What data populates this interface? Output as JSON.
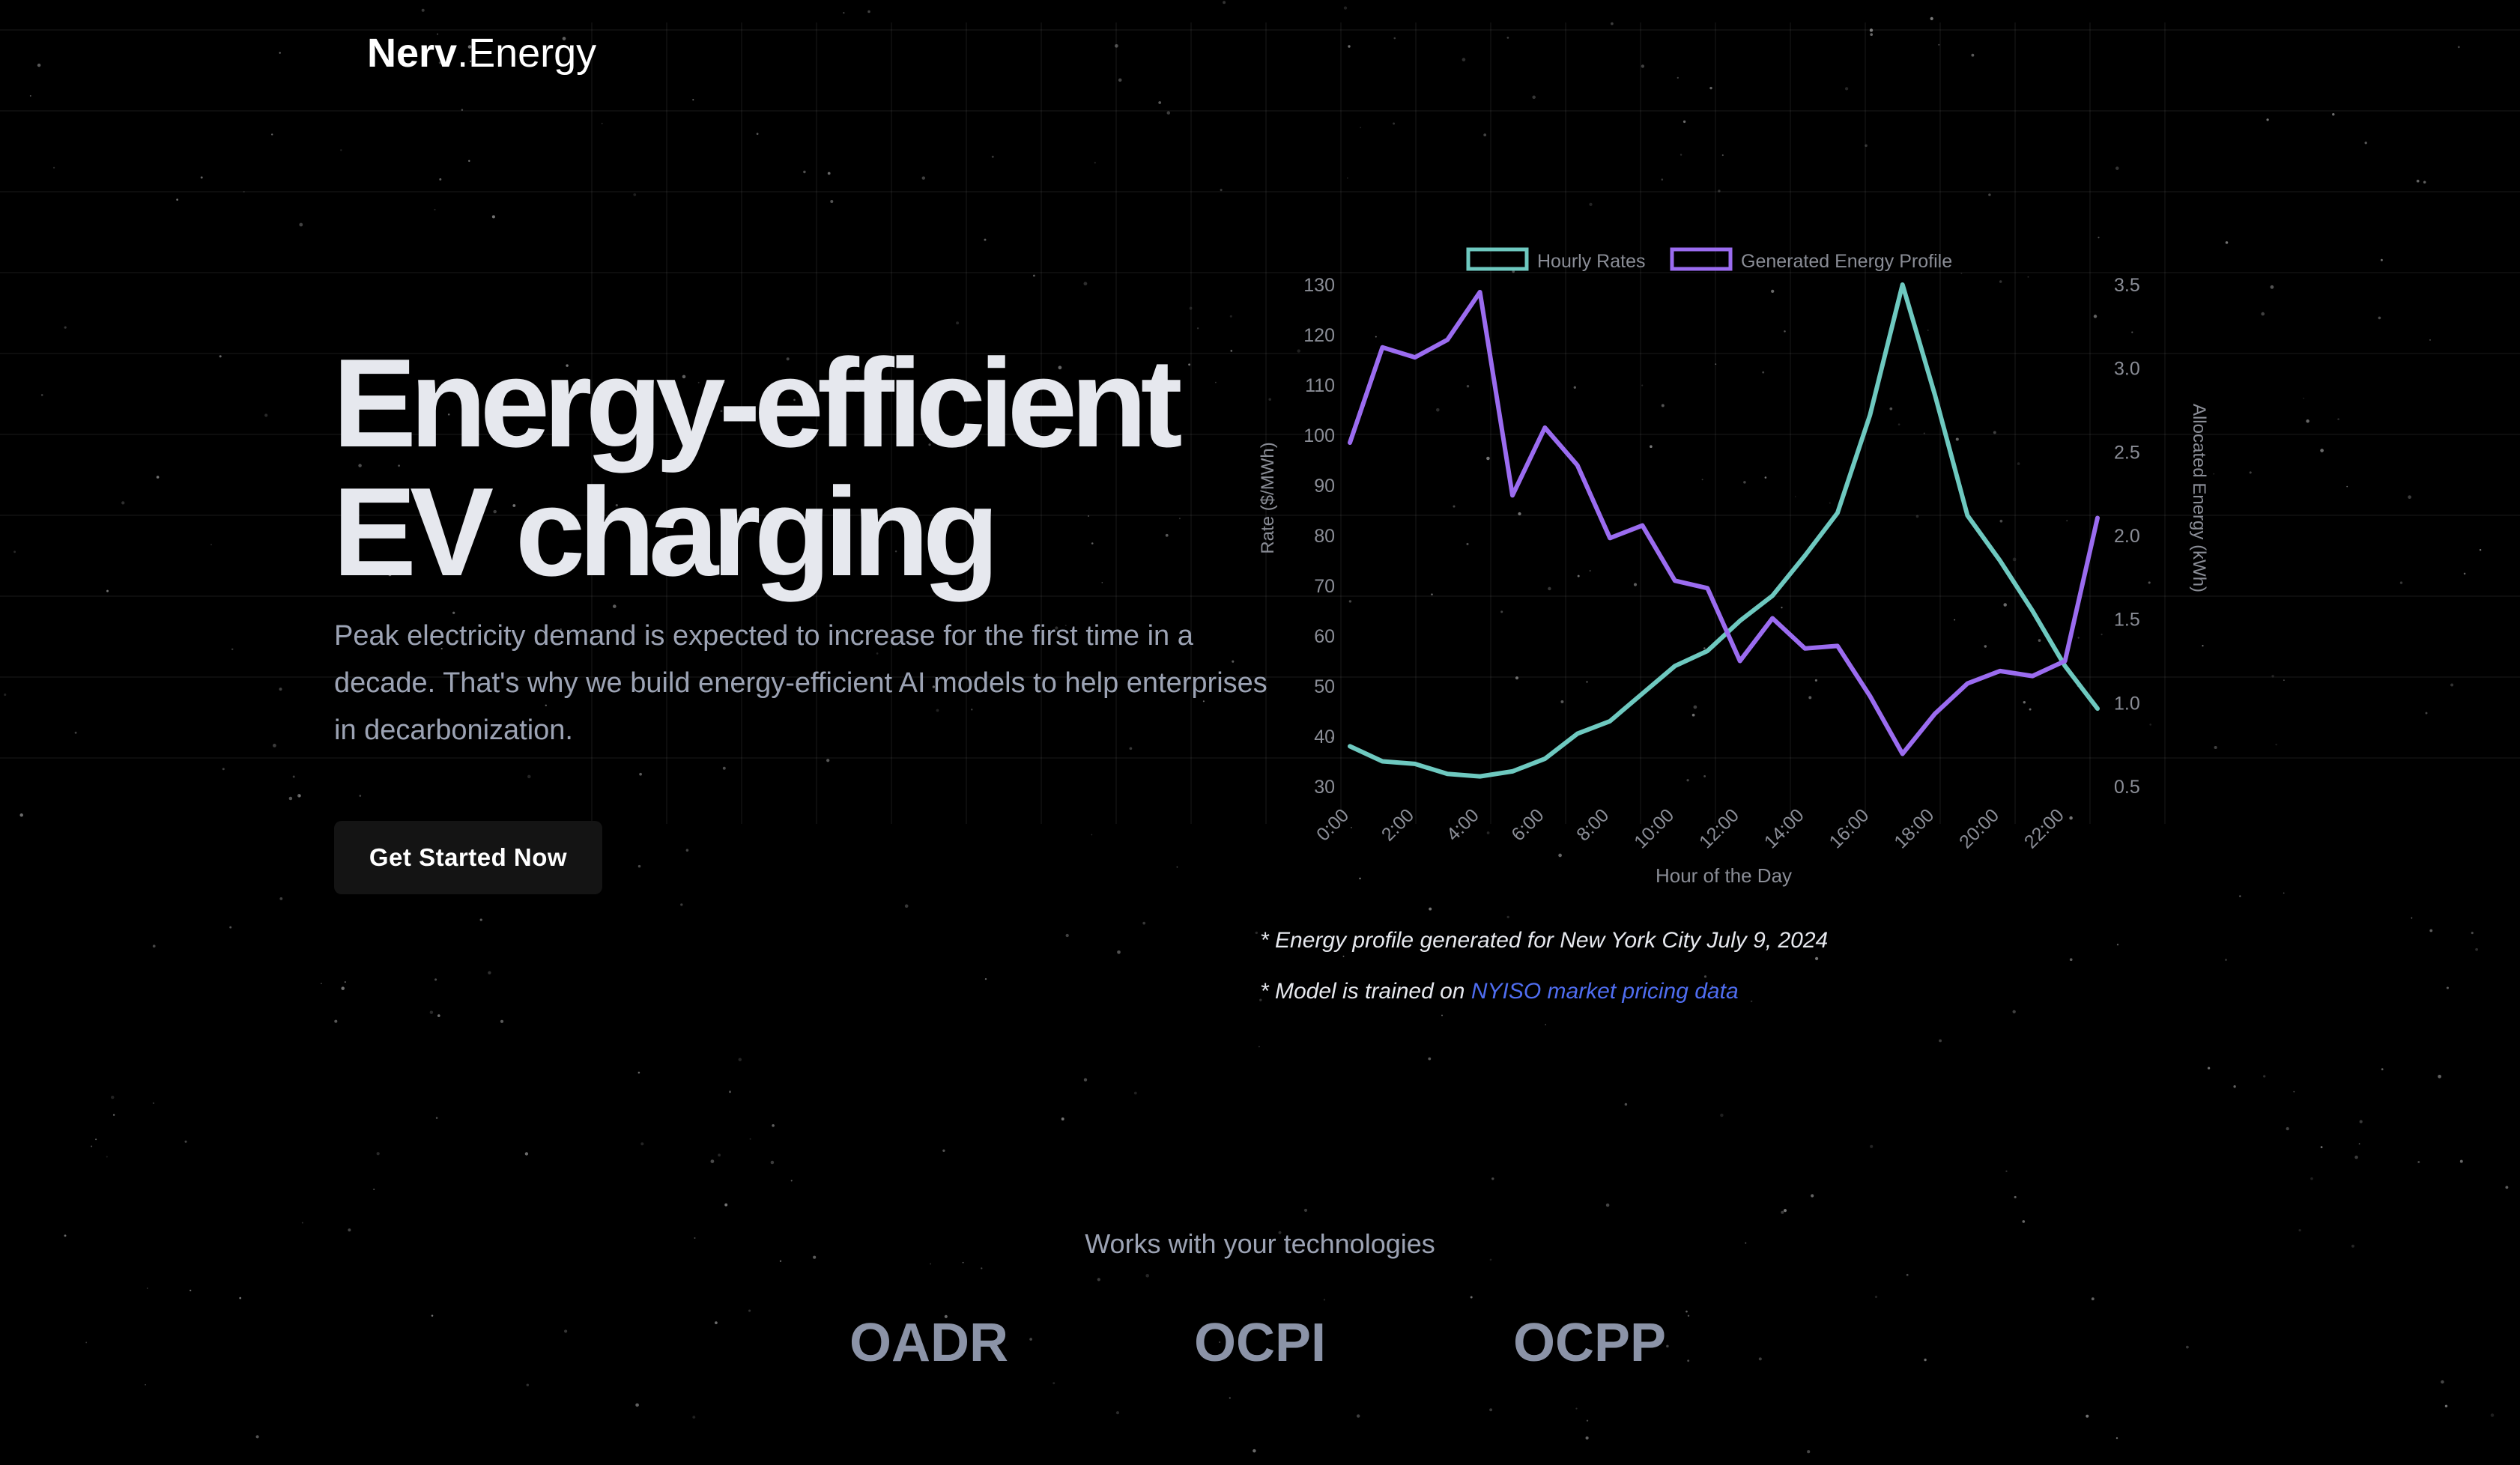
{
  "header": {
    "logo_bold": "Nerv",
    "logo_light": ".Energy"
  },
  "hero": {
    "title_line1": "Energy-efficient",
    "title_line2": "EV charging",
    "description": "Peak electricity demand is expected to increase for the first time in a decade. That's why we build energy-efficient AI models to help enterprises in decarbonization.",
    "cta_label": "Get Started Now"
  },
  "notes": {
    "note1": "* Energy profile generated for New York City July 9, 2024",
    "note2_prefix": "* Model is trained on ",
    "note2_link": "NYISO market pricing data"
  },
  "technologies": {
    "heading": "Works with your technologies",
    "items": [
      "OADR",
      "OCPI",
      "OCPP"
    ]
  },
  "colors": {
    "background": "#000000",
    "hourly_rates": "#6ec9c0",
    "energy_profile": "#9b6cf0",
    "link": "#4f6df0"
  },
  "chart_data": {
    "type": "line",
    "title": "",
    "xlabel": "Hour of the Day",
    "ylabel_left": "Rate ($/MWh)",
    "ylabel_right": "Allocated Energy (kWh)",
    "x": [
      "0:00",
      "1:00",
      "2:00",
      "3:00",
      "4:00",
      "5:00",
      "6:00",
      "7:00",
      "8:00",
      "9:00",
      "10:00",
      "11:00",
      "12:00",
      "13:00",
      "14:00",
      "15:00",
      "16:00",
      "17:00",
      "18:00",
      "19:00",
      "20:00",
      "21:00",
      "22:00",
      "23:00"
    ],
    "x_tick_labels": [
      "0:00",
      "2:00",
      "4:00",
      "6:00",
      "8:00",
      "10:00",
      "12:00",
      "14:00",
      "16:00",
      "18:00",
      "20:00",
      "22:00"
    ],
    "ylim_left": [
      30,
      130
    ],
    "ylim_right": [
      0.5,
      3.5
    ],
    "y_ticks_left": [
      30,
      40,
      50,
      60,
      70,
      80,
      90,
      100,
      110,
      120,
      130
    ],
    "y_ticks_right": [
      "0.5",
      "1.0",
      "1.5",
      "2.0",
      "2.5",
      "3.0",
      "3.5"
    ],
    "legend_position": "top",
    "grid": false,
    "series": [
      {
        "name": "Hourly Rates",
        "axis": "left",
        "color": "#6ec9c0",
        "values": [
          38,
          35,
          34.5,
          32.5,
          32,
          33,
          35.5,
          40.5,
          43,
          48.5,
          54,
          57,
          63,
          68,
          76,
          84.5,
          104,
          130,
          108,
          84,
          75,
          65,
          54,
          45.5
        ]
      },
      {
        "name": "Generated Energy Profile",
        "axis": "left",
        "color": "#9b6cf0",
        "values": [
          98.5,
          117.5,
          115.5,
          119,
          128.5,
          88,
          101.5,
          94,
          79.5,
          82,
          71,
          69.5,
          55,
          63.5,
          57.5,
          58,
          48,
          36.5,
          44.5,
          50.5,
          53,
          52,
          55,
          83.5
        ]
      }
    ]
  }
}
